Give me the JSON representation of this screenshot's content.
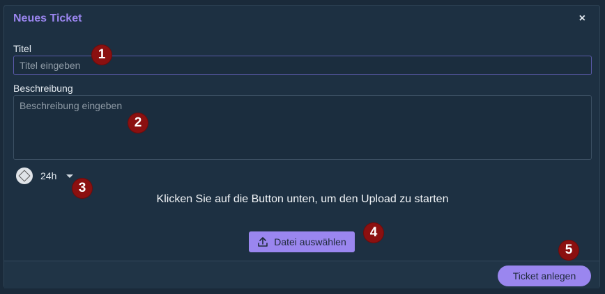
{
  "dialog": {
    "title": "Neues Ticket",
    "close_label": "×"
  },
  "form": {
    "title_label": "Titel",
    "title_placeholder": "Titel eingeben",
    "description_label": "Beschreibung",
    "description_placeholder": "Beschreibung eingeben",
    "priority_value": "24h",
    "priority_icon": "diamond-icon"
  },
  "upload": {
    "instruction": "Klicken Sie auf die Button unten, um den Upload zu starten",
    "button_label": "Datei auswählen",
    "button_icon": "upload-icon"
  },
  "footer": {
    "submit_label": "Ticket anlegen"
  },
  "markers": [
    "1",
    "2",
    "3",
    "4",
    "5"
  ],
  "colors": {
    "accent": "#9a86ef",
    "background": "#1d3042",
    "marker": "#8b1010"
  }
}
